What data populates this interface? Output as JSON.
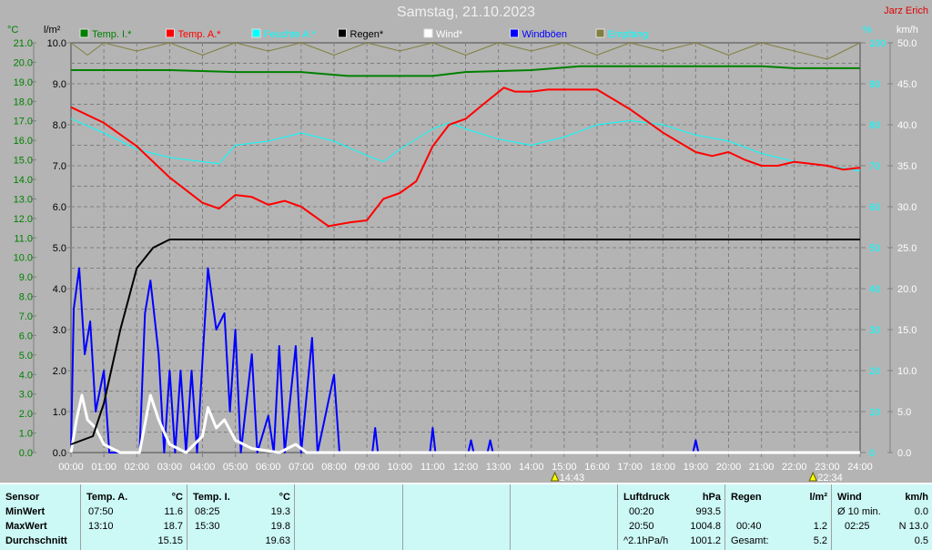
{
  "title": "Samstag, 21.10.2023",
  "author": "Jarz Erich",
  "colors": {
    "background": "#b4b4b4",
    "temp_i": "#008000",
    "temp_a": "#ff0000",
    "humidity": "#00ffff",
    "rain": "#000000",
    "wind": "#ffffff",
    "gusts": "#0000ff",
    "reception": "#808040"
  },
  "chart_data": {
    "type": "line",
    "title": "Samstag, 21.10.2023",
    "x_ticks": [
      "00:00",
      "01:00",
      "02:00",
      "03:00",
      "04:00",
      "05:00",
      "06:00",
      "07:00",
      "08:00",
      "09:00",
      "10:00",
      "11:00",
      "12:00",
      "13:00",
      "14:00",
      "15:00",
      "16:00",
      "17:00",
      "18:00",
      "19:00",
      "20:00",
      "21:00",
      "22:00",
      "23:00",
      "24:00"
    ],
    "xlim": [
      "00:00",
      "24:00"
    ],
    "axes": {
      "temp": {
        "unit": "°C",
        "range": [
          0,
          21
        ],
        "ticks": [
          "0.0",
          "1.0",
          "2.0",
          "3.0",
          "4.0",
          "5.0",
          "6.0",
          "7.0",
          "8.0",
          "9.0",
          "10.0",
          "11.0",
          "12.0",
          "13.0",
          "14.0",
          "15.0",
          "16.0",
          "17.0",
          "18.0",
          "19.0",
          "20.0",
          "21.0"
        ]
      },
      "rain": {
        "unit": "l/m²",
        "range": [
          0,
          10
        ],
        "ticks": [
          "0.0",
          "1.0",
          "2.0",
          "3.0",
          "4.0",
          "5.0",
          "6.0",
          "7.0",
          "8.0",
          "9.0",
          "10.0"
        ]
      },
      "humidity": {
        "unit": "%",
        "range": [
          0,
          100
        ],
        "ticks": [
          "0",
          "10",
          "20",
          "30",
          "40",
          "50",
          "60",
          "70",
          "80",
          "90",
          "100"
        ]
      },
      "wind": {
        "unit": "km/h",
        "range": [
          0,
          50
        ],
        "ticks": [
          "0.0",
          "5.0",
          "10.0",
          "15.0",
          "20.0",
          "25.0",
          "30.0",
          "35.0",
          "40.0",
          "45.0",
          "50.0"
        ]
      }
    },
    "grid": true,
    "legend_position": "top",
    "legend": [
      {
        "label": "Temp. I.*",
        "color": "#008000"
      },
      {
        "label": "Temp. A.*",
        "color": "#ff0000"
      },
      {
        "label": "Feuchte A.*",
        "color": "#00ffff"
      },
      {
        "label": "Regen*",
        "color": "#000000"
      },
      {
        "label": "Wind*",
        "color": "#ffffff"
      },
      {
        "label": "Windböen",
        "color": "#0000ff"
      },
      {
        "label": "Empfang",
        "color": "#808040"
      }
    ],
    "series": [
      {
        "name": "Temp. I.*",
        "axis": "temp",
        "color": "#008000",
        "points": [
          [
            "00:00",
            19.6
          ],
          [
            "03:00",
            19.6
          ],
          [
            "05:00",
            19.5
          ],
          [
            "07:00",
            19.5
          ],
          [
            "08:25",
            19.3
          ],
          [
            "11:00",
            19.3
          ],
          [
            "12:00",
            19.5
          ],
          [
            "14:00",
            19.6
          ],
          [
            "15:30",
            19.8
          ],
          [
            "21:00",
            19.8
          ],
          [
            "22:00",
            19.7
          ],
          [
            "24:00",
            19.7
          ]
        ]
      },
      {
        "name": "Temp. A.*",
        "axis": "temp",
        "color": "#ff0000",
        "points": [
          [
            "00:00",
            17.7
          ],
          [
            "01:00",
            16.9
          ],
          [
            "02:00",
            15.7
          ],
          [
            "03:00",
            14.1
          ],
          [
            "04:00",
            12.8
          ],
          [
            "04:30",
            12.5
          ],
          [
            "05:00",
            13.2
          ],
          [
            "05:30",
            13.1
          ],
          [
            "06:00",
            12.7
          ],
          [
            "06:30",
            12.9
          ],
          [
            "07:00",
            12.6
          ],
          [
            "07:50",
            11.6
          ],
          [
            "08:30",
            11.8
          ],
          [
            "09:00",
            11.9
          ],
          [
            "09:30",
            13.0
          ],
          [
            "10:00",
            13.3
          ],
          [
            "10:30",
            13.9
          ],
          [
            "11:00",
            15.7
          ],
          [
            "11:30",
            16.8
          ],
          [
            "12:00",
            17.1
          ],
          [
            "12:30",
            17.8
          ],
          [
            "13:10",
            18.7
          ],
          [
            "13:30",
            18.5
          ],
          [
            "14:00",
            18.5
          ],
          [
            "14:30",
            18.6
          ],
          [
            "15:00",
            18.6
          ],
          [
            "16:00",
            18.6
          ],
          [
            "16:30",
            18.1
          ],
          [
            "17:00",
            17.6
          ],
          [
            "17:30",
            17.0
          ],
          [
            "18:00",
            16.4
          ],
          [
            "19:00",
            15.4
          ],
          [
            "19:30",
            15.2
          ],
          [
            "20:00",
            15.4
          ],
          [
            "20:30",
            15.0
          ],
          [
            "21:00",
            14.7
          ],
          [
            "21:30",
            14.7
          ],
          [
            "22:00",
            14.9
          ],
          [
            "22:30",
            14.8
          ],
          [
            "23:00",
            14.7
          ],
          [
            "23:30",
            14.5
          ],
          [
            "24:00",
            14.6
          ]
        ]
      },
      {
        "name": "Feuchte A.*",
        "axis": "humidity",
        "color": "#00ffff",
        "points": [
          [
            "00:00",
            81.5
          ],
          [
            "01:00",
            78
          ],
          [
            "02:00",
            74
          ],
          [
            "03:00",
            72
          ],
          [
            "04:00",
            71
          ],
          [
            "04:30",
            70.5
          ],
          [
            "05:00",
            75
          ],
          [
            "06:00",
            76
          ],
          [
            "07:00",
            78
          ],
          [
            "08:00",
            76
          ],
          [
            "09:00",
            72.5
          ],
          [
            "09:30",
            71
          ],
          [
            "10:00",
            74
          ],
          [
            "11:00",
            79
          ],
          [
            "11:30",
            80.5
          ],
          [
            "12:00",
            79
          ],
          [
            "13:00",
            76.5
          ],
          [
            "14:00",
            75
          ],
          [
            "15:00",
            77
          ],
          [
            "16:00",
            80
          ],
          [
            "17:00",
            81
          ],
          [
            "18:00",
            80
          ],
          [
            "19:00",
            77.5
          ],
          [
            "20:00",
            76
          ],
          [
            "21:00",
            73
          ],
          [
            "22:00",
            71
          ],
          [
            "23:00",
            70
          ],
          [
            "24:00",
            68.7
          ]
        ]
      },
      {
        "name": "Regen*",
        "axis": "rain",
        "color": "#000000",
        "points": [
          [
            "00:00",
            0.2
          ],
          [
            "00:20",
            0.3
          ],
          [
            "00:40",
            0.4
          ],
          [
            "01:00",
            1.2
          ],
          [
            "01:30",
            3.0
          ],
          [
            "02:00",
            4.5
          ],
          [
            "02:30",
            5.0
          ],
          [
            "03:00",
            5.2
          ],
          [
            "24:00",
            5.2
          ]
        ]
      },
      {
        "name": "Wind*",
        "axis": "wind",
        "color": "#ffffff",
        "points": [
          [
            "00:00",
            0
          ],
          [
            "00:10",
            4
          ],
          [
            "00:20",
            7
          ],
          [
            "00:30",
            4
          ],
          [
            "00:45",
            3
          ],
          [
            "01:00",
            1
          ],
          [
            "01:30",
            0
          ],
          [
            "02:05",
            0
          ],
          [
            "02:25",
            7
          ],
          [
            "02:40",
            4
          ],
          [
            "03:00",
            1
          ],
          [
            "03:30",
            0
          ],
          [
            "04:00",
            2
          ],
          [
            "04:10",
            5.5
          ],
          [
            "04:25",
            3
          ],
          [
            "04:40",
            4
          ],
          [
            "05:00",
            1.5
          ],
          [
            "05:30",
            0.5
          ],
          [
            "06:20",
            0
          ],
          [
            "06:50",
            1
          ],
          [
            "07:10",
            0
          ],
          [
            "24:00",
            0
          ]
        ]
      },
      {
        "name": "Windböen",
        "axis": "wind",
        "color": "#0000ff",
        "points": [
          [
            "00:00",
            0
          ],
          [
            "00:05",
            17.5
          ],
          [
            "00:15",
            22.5
          ],
          [
            "00:25",
            12
          ],
          [
            "00:35",
            16
          ],
          [
            "00:45",
            5
          ],
          [
            "01:00",
            10
          ],
          [
            "01:10",
            0
          ],
          [
            "02:05",
            0
          ],
          [
            "02:15",
            17
          ],
          [
            "02:25",
            21
          ],
          [
            "02:40",
            12
          ],
          [
            "02:50",
            0
          ],
          [
            "03:00",
            10
          ],
          [
            "03:10",
            0
          ],
          [
            "03:20",
            10
          ],
          [
            "03:30",
            0
          ],
          [
            "03:40",
            10
          ],
          [
            "03:50",
            0
          ],
          [
            "04:10",
            22.5
          ],
          [
            "04:25",
            15
          ],
          [
            "04:40",
            17
          ],
          [
            "04:50",
            5
          ],
          [
            "05:00",
            15
          ],
          [
            "05:10",
            0
          ],
          [
            "05:30",
            12
          ],
          [
            "05:40",
            0
          ],
          [
            "06:00",
            4.5
          ],
          [
            "06:10",
            0
          ],
          [
            "06:20",
            13
          ],
          [
            "06:30",
            0
          ],
          [
            "06:50",
            13
          ],
          [
            "07:00",
            0
          ],
          [
            "07:20",
            14
          ],
          [
            "07:30",
            0
          ],
          [
            "08:00",
            9.5
          ],
          [
            "08:10",
            0
          ],
          [
            "09:10",
            0
          ],
          [
            "09:15",
            3
          ],
          [
            "09:20",
            0
          ],
          [
            "10:55",
            0
          ],
          [
            "11:00",
            3
          ],
          [
            "11:05",
            0
          ],
          [
            "12:05",
            0
          ],
          [
            "12:10",
            1.5
          ],
          [
            "12:15",
            0
          ],
          [
            "12:40",
            0
          ],
          [
            "12:45",
            1.5
          ],
          [
            "12:50",
            0
          ],
          [
            "18:55",
            0
          ],
          [
            "19:00",
            1.5
          ],
          [
            "19:05",
            0
          ],
          [
            "24:00",
            0
          ]
        ]
      },
      {
        "name": "Empfang",
        "axis": "humidity",
        "color": "#808040",
        "points": [
          [
            "00:00",
            100
          ],
          [
            "00:30",
            97
          ],
          [
            "01:00",
            100
          ],
          [
            "02:00",
            98
          ],
          [
            "03:00",
            100
          ],
          [
            "04:00",
            97
          ],
          [
            "05:00",
            100
          ],
          [
            "06:00",
            98
          ],
          [
            "07:00",
            100
          ],
          [
            "08:00",
            97
          ],
          [
            "09:00",
            100
          ],
          [
            "10:00",
            98
          ],
          [
            "11:00",
            100
          ],
          [
            "12:00",
            97
          ],
          [
            "13:00",
            100
          ],
          [
            "14:00",
            98
          ],
          [
            "15:00",
            100
          ],
          [
            "16:00",
            97
          ],
          [
            "17:00",
            100
          ],
          [
            "18:00",
            98
          ],
          [
            "19:00",
            100
          ],
          [
            "20:00",
            97
          ],
          [
            "21:00",
            100
          ],
          [
            "22:00",
            98
          ],
          [
            "23:00",
            96
          ],
          [
            "24:00",
            100
          ]
        ]
      }
    ],
    "annotations": [
      {
        "time": "14:43",
        "label": "14:43",
        "icon": "moon-rise-icon"
      },
      {
        "time": "22:34",
        "label": "22:34",
        "icon": "moon-set-icon"
      }
    ]
  },
  "table": {
    "sensor": {
      "header": "Sensor",
      "rows": [
        "MinWert",
        "MaxWert",
        "Durchschnitt"
      ]
    },
    "temp_a": {
      "header": "Temp. A.",
      "unit": "°C",
      "min_time": "07:50",
      "min": "11.6",
      "max_time": "13:10",
      "max": "18.7",
      "avg": "15.15"
    },
    "temp_i": {
      "header": "Temp. I.",
      "unit": "°C",
      "min_time": "08:25",
      "min": "19.3",
      "max_time": "15:30",
      "max": "19.8",
      "avg": "19.63"
    },
    "pressure": {
      "header": "Luftdruck",
      "unit": "hPa",
      "min_time": "00:20",
      "min": "993.5",
      "max_time": "20:50",
      "max": "1004.8",
      "trend": "^2.1hPa/h",
      "avg": "1001.2"
    },
    "rain": {
      "header": "Regen",
      "unit": "l/m²",
      "max_time": "00:40",
      "max": "1.2",
      "total_label": "Gesamt:",
      "total": "5.2"
    },
    "wind": {
      "header": "Wind",
      "unit": "km/h",
      "avg_label": "Ø 10 min.",
      "avg": "0.0",
      "max_time": "02:25",
      "max": "N 13.0",
      "day_avg": "0.5"
    }
  }
}
